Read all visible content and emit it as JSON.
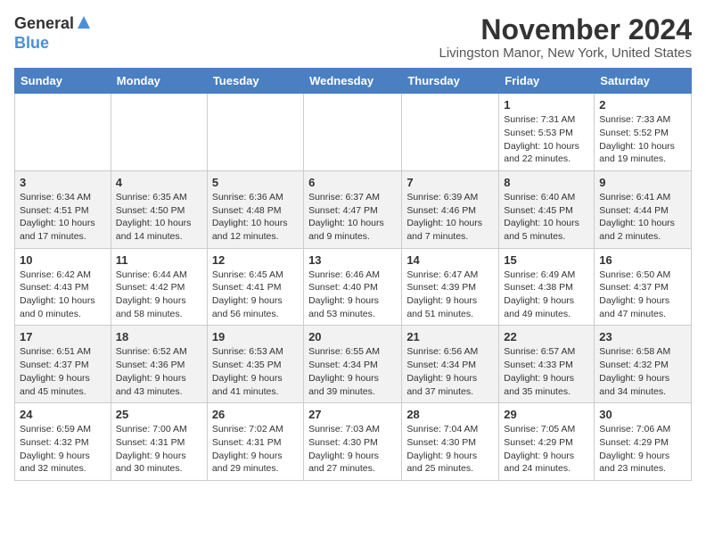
{
  "logo": {
    "general": "General",
    "blue": "Blue"
  },
  "title": "November 2024",
  "location": "Livingston Manor, New York, United States",
  "headers": [
    "Sunday",
    "Monday",
    "Tuesday",
    "Wednesday",
    "Thursday",
    "Friday",
    "Saturday"
  ],
  "rows": [
    [
      {
        "day": "",
        "info": ""
      },
      {
        "day": "",
        "info": ""
      },
      {
        "day": "",
        "info": ""
      },
      {
        "day": "",
        "info": ""
      },
      {
        "day": "",
        "info": ""
      },
      {
        "day": "1",
        "info": "Sunrise: 7:31 AM\nSunset: 5:53 PM\nDaylight: 10 hours\nand 22 minutes."
      },
      {
        "day": "2",
        "info": "Sunrise: 7:33 AM\nSunset: 5:52 PM\nDaylight: 10 hours\nand 19 minutes."
      }
    ],
    [
      {
        "day": "3",
        "info": "Sunrise: 6:34 AM\nSunset: 4:51 PM\nDaylight: 10 hours\nand 17 minutes."
      },
      {
        "day": "4",
        "info": "Sunrise: 6:35 AM\nSunset: 4:50 PM\nDaylight: 10 hours\nand 14 minutes."
      },
      {
        "day": "5",
        "info": "Sunrise: 6:36 AM\nSunset: 4:48 PM\nDaylight: 10 hours\nand 12 minutes."
      },
      {
        "day": "6",
        "info": "Sunrise: 6:37 AM\nSunset: 4:47 PM\nDaylight: 10 hours\nand 9 minutes."
      },
      {
        "day": "7",
        "info": "Sunrise: 6:39 AM\nSunset: 4:46 PM\nDaylight: 10 hours\nand 7 minutes."
      },
      {
        "day": "8",
        "info": "Sunrise: 6:40 AM\nSunset: 4:45 PM\nDaylight: 10 hours\nand 5 minutes."
      },
      {
        "day": "9",
        "info": "Sunrise: 6:41 AM\nSunset: 4:44 PM\nDaylight: 10 hours\nand 2 minutes."
      }
    ],
    [
      {
        "day": "10",
        "info": "Sunrise: 6:42 AM\nSunset: 4:43 PM\nDaylight: 10 hours\nand 0 minutes."
      },
      {
        "day": "11",
        "info": "Sunrise: 6:44 AM\nSunset: 4:42 PM\nDaylight: 9 hours\nand 58 minutes."
      },
      {
        "day": "12",
        "info": "Sunrise: 6:45 AM\nSunset: 4:41 PM\nDaylight: 9 hours\nand 56 minutes."
      },
      {
        "day": "13",
        "info": "Sunrise: 6:46 AM\nSunset: 4:40 PM\nDaylight: 9 hours\nand 53 minutes."
      },
      {
        "day": "14",
        "info": "Sunrise: 6:47 AM\nSunset: 4:39 PM\nDaylight: 9 hours\nand 51 minutes."
      },
      {
        "day": "15",
        "info": "Sunrise: 6:49 AM\nSunset: 4:38 PM\nDaylight: 9 hours\nand 49 minutes."
      },
      {
        "day": "16",
        "info": "Sunrise: 6:50 AM\nSunset: 4:37 PM\nDaylight: 9 hours\nand 47 minutes."
      }
    ],
    [
      {
        "day": "17",
        "info": "Sunrise: 6:51 AM\nSunset: 4:37 PM\nDaylight: 9 hours\nand 45 minutes."
      },
      {
        "day": "18",
        "info": "Sunrise: 6:52 AM\nSunset: 4:36 PM\nDaylight: 9 hours\nand 43 minutes."
      },
      {
        "day": "19",
        "info": "Sunrise: 6:53 AM\nSunset: 4:35 PM\nDaylight: 9 hours\nand 41 minutes."
      },
      {
        "day": "20",
        "info": "Sunrise: 6:55 AM\nSunset: 4:34 PM\nDaylight: 9 hours\nand 39 minutes."
      },
      {
        "day": "21",
        "info": "Sunrise: 6:56 AM\nSunset: 4:34 PM\nDaylight: 9 hours\nand 37 minutes."
      },
      {
        "day": "22",
        "info": "Sunrise: 6:57 AM\nSunset: 4:33 PM\nDaylight: 9 hours\nand 35 minutes."
      },
      {
        "day": "23",
        "info": "Sunrise: 6:58 AM\nSunset: 4:32 PM\nDaylight: 9 hours\nand 34 minutes."
      }
    ],
    [
      {
        "day": "24",
        "info": "Sunrise: 6:59 AM\nSunset: 4:32 PM\nDaylight: 9 hours\nand 32 minutes."
      },
      {
        "day": "25",
        "info": "Sunrise: 7:00 AM\nSunset: 4:31 PM\nDaylight: 9 hours\nand 30 minutes."
      },
      {
        "day": "26",
        "info": "Sunrise: 7:02 AM\nSunset: 4:31 PM\nDaylight: 9 hours\nand 29 minutes."
      },
      {
        "day": "27",
        "info": "Sunrise: 7:03 AM\nSunset: 4:30 PM\nDaylight: 9 hours\nand 27 minutes."
      },
      {
        "day": "28",
        "info": "Sunrise: 7:04 AM\nSunset: 4:30 PM\nDaylight: 9 hours\nand 25 minutes."
      },
      {
        "day": "29",
        "info": "Sunrise: 7:05 AM\nSunset: 4:29 PM\nDaylight: 9 hours\nand 24 minutes."
      },
      {
        "day": "30",
        "info": "Sunrise: 7:06 AM\nSunset: 4:29 PM\nDaylight: 9 hours\nand 23 minutes."
      }
    ]
  ]
}
